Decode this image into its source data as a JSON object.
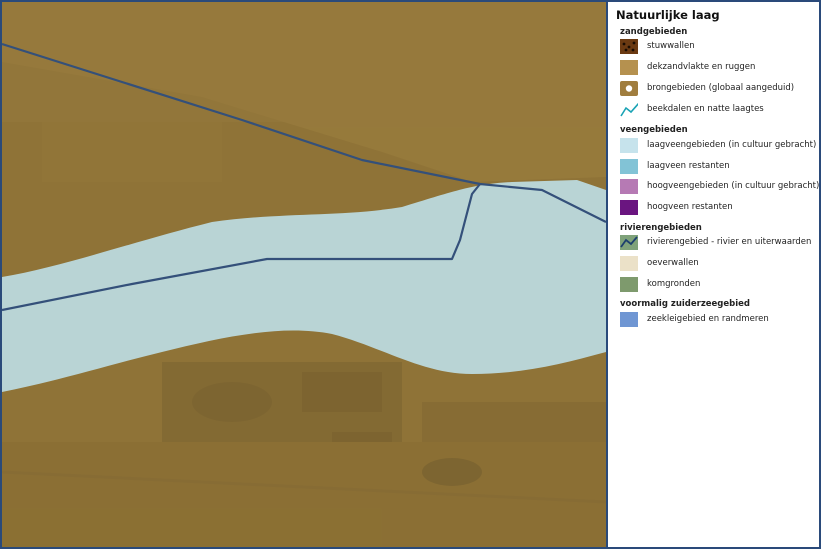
{
  "legend": {
    "title": "Natuurlijke laag",
    "groups": [
      {
        "title": "zandgebieden",
        "items": [
          {
            "label": "stuwwallen",
            "icon": "stuwwallen-swatch",
            "color": "#6b3a12"
          },
          {
            "label": "dekzandvlakte en ruggen",
            "icon": "dekzand-swatch",
            "color": "#b5914f"
          },
          {
            "label": "brongebieden (globaal aangeduid)",
            "icon": "brongebied-swatch",
            "color": "#a07d3e"
          },
          {
            "label": "beekdalen en natte laagtes",
            "icon": "beekdal-line-icon",
            "color": "#1aa3b5"
          }
        ]
      },
      {
        "title": "veengebieden",
        "items": [
          {
            "label": "laagveengebieden (in cultuur gebracht)",
            "icon": "laagveen-cultuur-swatch",
            "color": "#c6e3ec"
          },
          {
            "label": "laagveen restanten",
            "icon": "laagveen-restant-swatch",
            "color": "#82c3d6"
          },
          {
            "label": "hoogveengebieden (in cultuur gebracht)",
            "icon": "hoogveen-cultuur-swatch",
            "color": "#b67ab4"
          },
          {
            "label": "hoogveen restanten",
            "icon": "hoogveen-restant-swatch",
            "color": "#6a1580"
          }
        ]
      },
      {
        "title": "rivierengebieden",
        "items": [
          {
            "label": "rivierengebied - rivier en uiterwaarden",
            "icon": "rivier-swatch",
            "color": "#7fa27a"
          },
          {
            "label": "oeverwallen",
            "icon": "oeverwal-swatch",
            "color": "#ebe1c8"
          },
          {
            "label": "komgronden",
            "icon": "komgrond-swatch",
            "color": "#7e9a6d"
          }
        ]
      },
      {
        "title": "voormalig zuiderzeegebied",
        "items": [
          {
            "label": "zeekleigebied en randmeren",
            "icon": "zeeklei-swatch",
            "color": "#6f96d3"
          }
        ]
      }
    ]
  },
  "map": {
    "sand_color": "#917436",
    "peat_color": "#bfe1ec",
    "line_color": "#34507a"
  }
}
